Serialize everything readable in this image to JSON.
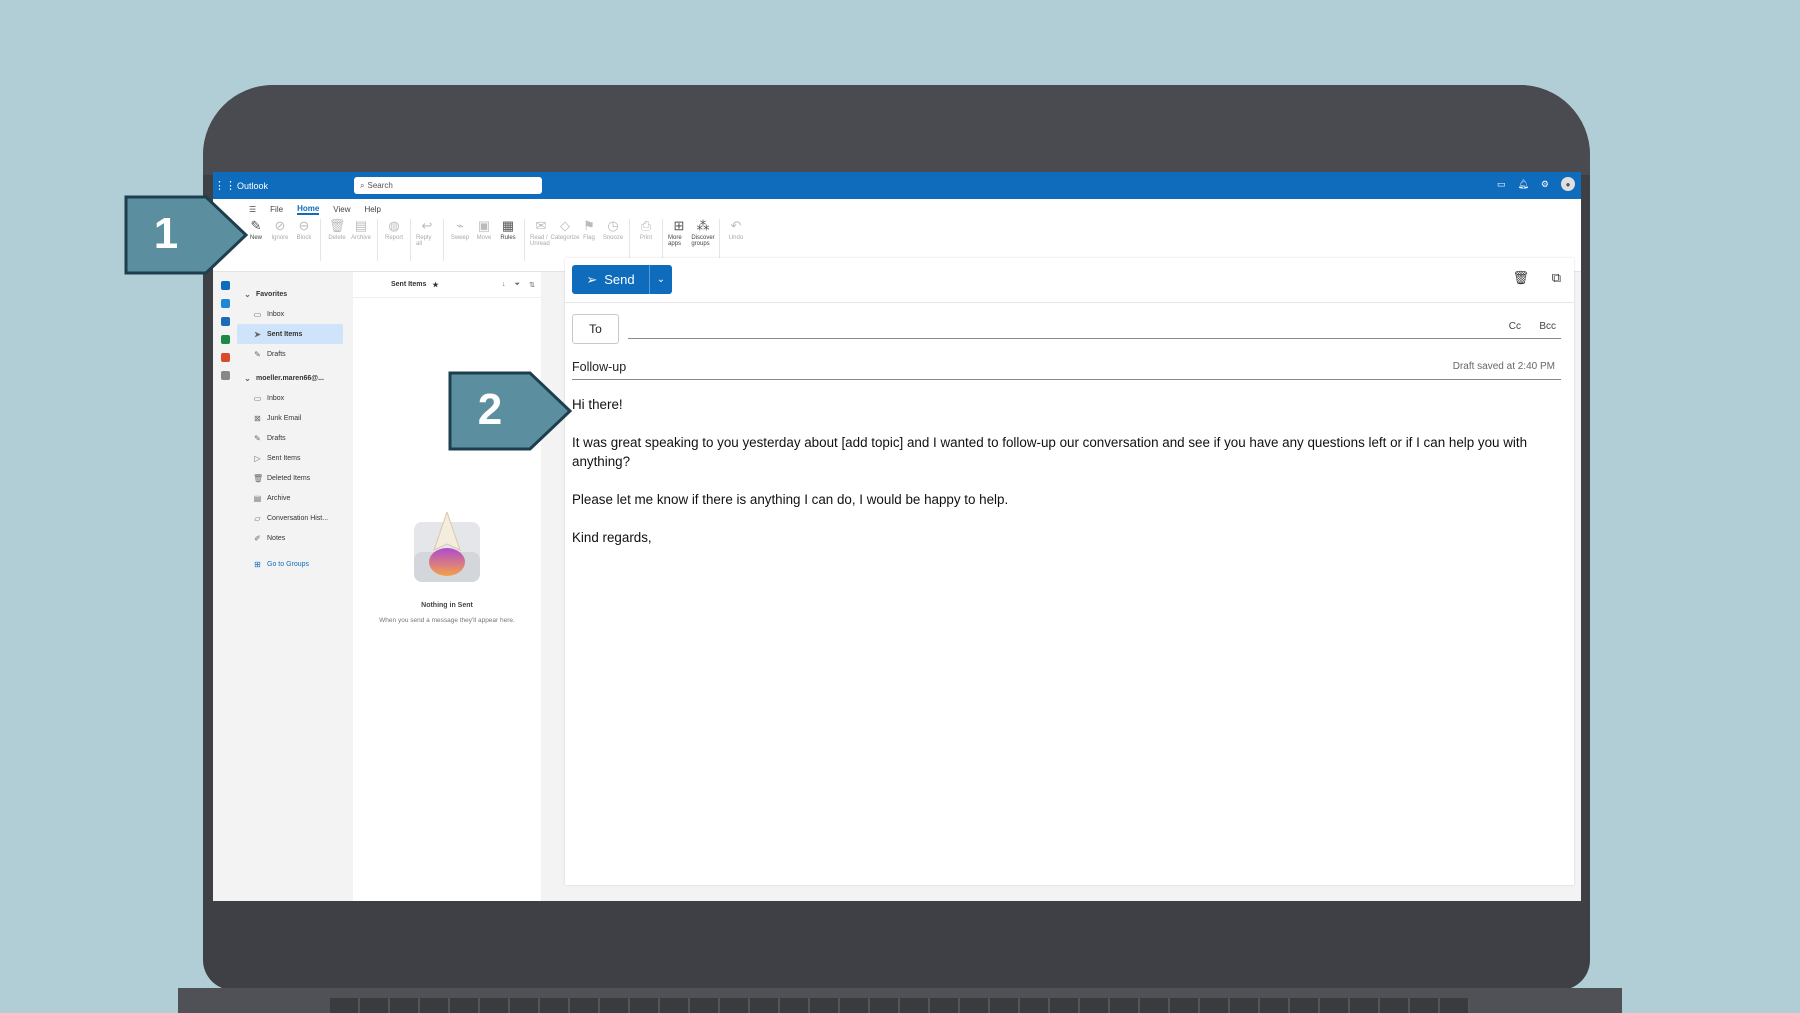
{
  "app": {
    "name": "Outlook"
  },
  "search": {
    "placeholder": "Search"
  },
  "ribbon": {
    "menus": [
      "File",
      "Home",
      "View",
      "Help"
    ],
    "buttons": {
      "new": "New",
      "ignore": "Ignore",
      "block": "Block",
      "delete": "Delete",
      "archive": "Archive",
      "report": "Report",
      "reply_all": "Reply all",
      "sweep": "Sweep",
      "move": "Move",
      "rules": "Rules",
      "read_unread": "Read / Unread",
      "categorize": "Categorize",
      "flag": "Flag",
      "snooze": "Snooze",
      "print": "Print",
      "more_apps": "More apps",
      "discover_groups": "Discover groups",
      "undo": "Undo"
    }
  },
  "folders": {
    "favorites_label": "Favorites",
    "favorites": [
      "Inbox",
      "Sent Items",
      "Drafts"
    ],
    "account_label": "moeller.maren66@...",
    "account": [
      "Inbox",
      "Junk Email",
      "Drafts",
      "Sent Items",
      "Deleted Items",
      "Archive",
      "Conversation Hist...",
      "Notes"
    ],
    "groups_link": "Go to Groups"
  },
  "message_list": {
    "title": "Sent Items",
    "empty_title": "Nothing in Sent",
    "empty_sub": "When you send a message they'll appear here."
  },
  "compose": {
    "send_label": "Send",
    "to_label": "To",
    "cc_label": "Cc",
    "bcc_label": "Bcc",
    "subject": "Follow-up",
    "draft_status": "Draft saved at 2:40 PM",
    "body": {
      "greeting": "Hi there!",
      "p1": "It was great speaking to you yesterday about [add topic] and I wanted to follow-up our conversation and see if you have any questions left or if I can help you with anything?",
      "p2": "Please let me know if there is anything I can do, I would be happy to help.",
      "closing": "Kind regards,"
    }
  },
  "callouts": {
    "one": "1",
    "two": "2"
  },
  "colors": {
    "background": "#b1cdd6",
    "brand": "#0f6cbd",
    "callout": "#5b8fa0",
    "callout_border": "#1d3f4d"
  }
}
